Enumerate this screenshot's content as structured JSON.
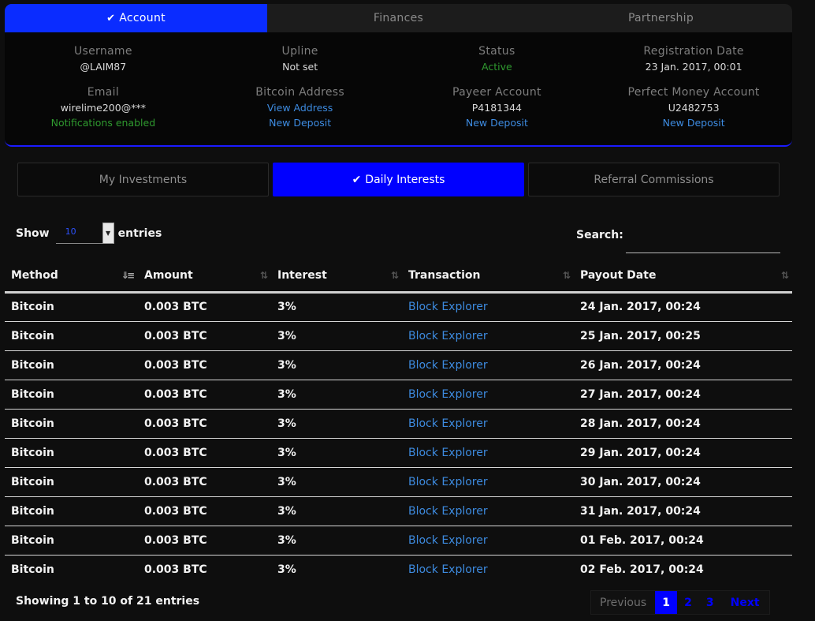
{
  "top_tabs": [
    {
      "label": "Account",
      "active": true
    },
    {
      "label": "Finances",
      "active": false
    },
    {
      "label": "Partnership",
      "active": false
    }
  ],
  "account": {
    "username": {
      "label": "Username",
      "value": "@LAIM87"
    },
    "upline": {
      "label": "Upline",
      "value": "Not set"
    },
    "status": {
      "label": "Status",
      "value": "Active"
    },
    "registration": {
      "label": "Registration Date",
      "value": "23 Jan. 2017, 00:01"
    },
    "email": {
      "label": "Email",
      "value": "wirelime200@***",
      "note": "Notifications enabled"
    },
    "bitcoin": {
      "label": "Bitcoin Address",
      "link": "View Address",
      "deposit": "New Deposit"
    },
    "payeer": {
      "label": "Payeer Account",
      "value": "P4181344",
      "deposit": "New Deposit"
    },
    "perfect_money": {
      "label": "Perfect Money Account",
      "value": "U2482753",
      "deposit": "New Deposit"
    }
  },
  "sub_tabs": [
    {
      "label": "My Investments",
      "active": false
    },
    {
      "label": "Daily Interests",
      "active": true
    },
    {
      "label": "Referral Commissions",
      "active": false
    }
  ],
  "length_menu": {
    "show": "Show",
    "value": "10",
    "entries": "entries"
  },
  "search": {
    "label": "Search:",
    "value": ""
  },
  "table": {
    "columns": [
      "Method",
      "Amount",
      "Interest",
      "Transaction",
      "Payout Date"
    ],
    "rows": [
      [
        "Bitcoin",
        "0.003 BTC",
        "3%",
        "Block Explorer",
        "24 Jan. 2017, 00:24"
      ],
      [
        "Bitcoin",
        "0.003 BTC",
        "3%",
        "Block Explorer",
        "25 Jan. 2017, 00:25"
      ],
      [
        "Bitcoin",
        "0.003 BTC",
        "3%",
        "Block Explorer",
        "26 Jan. 2017, 00:24"
      ],
      [
        "Bitcoin",
        "0.003 BTC",
        "3%",
        "Block Explorer",
        "27 Jan. 2017, 00:24"
      ],
      [
        "Bitcoin",
        "0.003 BTC",
        "3%",
        "Block Explorer",
        "28 Jan. 2017, 00:24"
      ],
      [
        "Bitcoin",
        "0.003 BTC",
        "3%",
        "Block Explorer",
        "29 Jan. 2017, 00:24"
      ],
      [
        "Bitcoin",
        "0.003 BTC",
        "3%",
        "Block Explorer",
        "30 Jan. 2017, 00:24"
      ],
      [
        "Bitcoin",
        "0.003 BTC",
        "3%",
        "Block Explorer",
        "31 Jan. 2017, 00:24"
      ],
      [
        "Bitcoin",
        "0.003 BTC",
        "3%",
        "Block Explorer",
        "01 Feb. 2017, 00:24"
      ],
      [
        "Bitcoin",
        "0.003 BTC",
        "3%",
        "Block Explorer",
        "02 Feb. 2017, 00:24"
      ]
    ]
  },
  "footer": {
    "info": "Showing 1 to 10 of 21 entries",
    "previous": "Previous",
    "pages": [
      "1",
      "2",
      "3"
    ],
    "current_page": "1",
    "next": "Next"
  },
  "colors": {
    "accent": "#0000ff",
    "link": "#3d8be0",
    "active_status": "#2f9a2f"
  }
}
